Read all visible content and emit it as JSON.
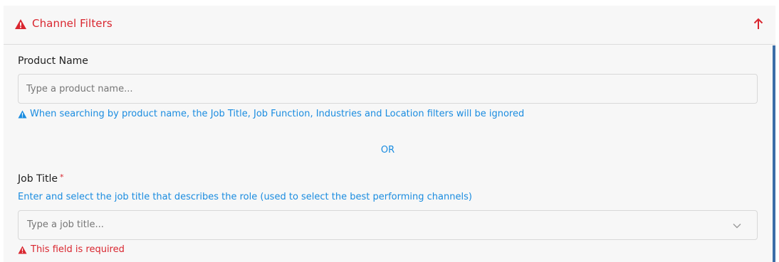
{
  "header": {
    "title": "Channel Filters",
    "warning_icon": "warning-triangle-icon",
    "toggle_icon": "arrow-up-icon"
  },
  "product_name": {
    "label": "Product Name",
    "placeholder": "Type a product name...",
    "value": "",
    "info_icon": "info-triangle-icon",
    "info_text": "When searching by product name, the Job Title, Job Function, Industries and Location filters will be ignored"
  },
  "separator": "OR",
  "job_title": {
    "label": "Job Title",
    "required_mark": "*",
    "helper": "Enter and select the job title that describes the role (used to select the best performing channels)",
    "placeholder": "Type a job title...",
    "dropdown_icon": "chevron-down-icon",
    "error_icon": "warning-triangle-icon",
    "error": "This field is required"
  },
  "colors": {
    "error_red": "#d9262f",
    "info_blue": "#1a8ce0",
    "scrollbar": "#3c6ea8",
    "panel_bg": "#f7f7f7"
  }
}
